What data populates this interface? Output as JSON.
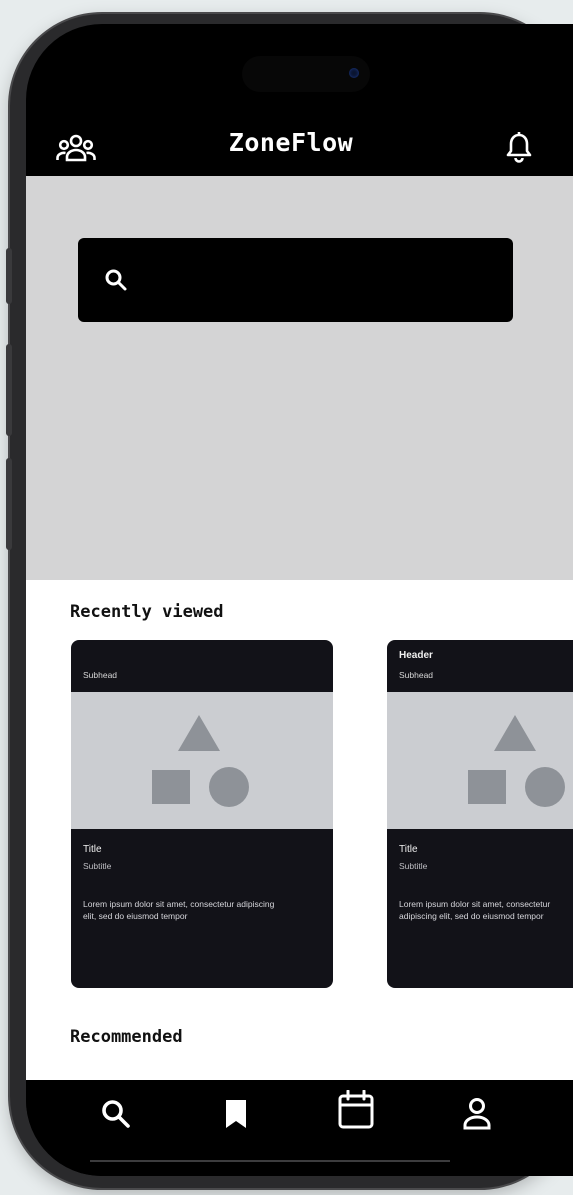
{
  "app": {
    "title": "ZoneFlow"
  },
  "icons": {
    "top_left": "group-icon",
    "top_right": "bell-icon",
    "search": "search-icon",
    "nav": [
      "search-icon",
      "bookmark-icon",
      "calendar-icon",
      "person-icon"
    ]
  },
  "search": {
    "value": "",
    "placeholder": ""
  },
  "sections": {
    "recently_viewed": "Recently viewed",
    "recommended": "Recommended"
  },
  "cards": [
    {
      "header": "",
      "subhead": "Subhead",
      "title": "Title",
      "subtitle": "Subtitle",
      "body": "Lorem ipsum dolor sit amet, consectetur adipiscing elit, sed do eiusmod tempor"
    },
    {
      "header": "Header",
      "subhead": "Subhead",
      "title": "Title",
      "subtitle": "Subtitle",
      "body": "Lorem ipsum dolor sit amet, consectetur adipiscing elit, sed do eiusmod tempor"
    }
  ],
  "colors": {
    "screen_bg": "#000000",
    "hero_bg": "#d4d4d5",
    "card_bg": "#121218",
    "media_bg": "#cbcdd1",
    "shape_fill": "#8e9298"
  }
}
